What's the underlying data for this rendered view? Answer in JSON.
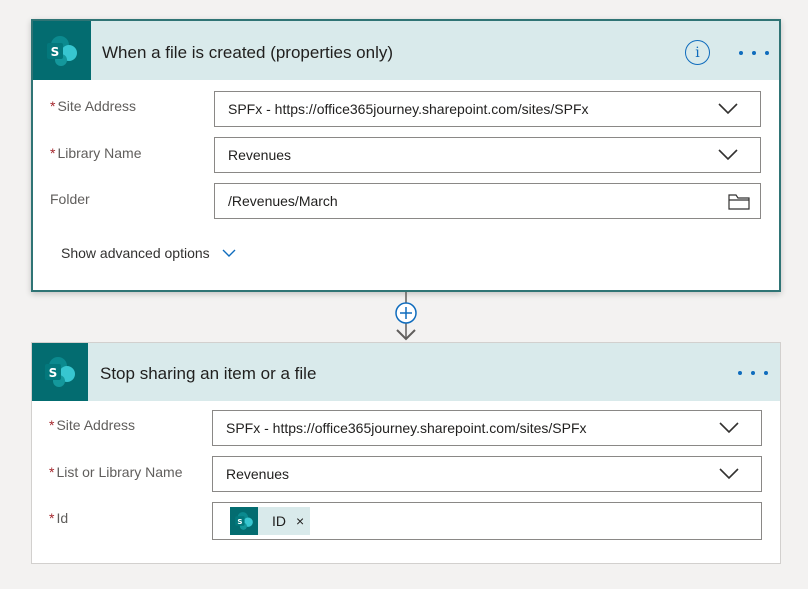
{
  "trigger": {
    "title": "When a file is created (properties only)",
    "icon": "sharepoint-icon",
    "fields": [
      {
        "label": "Site Address",
        "required_mark": "*",
        "value": "SPFx - https://office365journey.sharepoint.com/sites/SPFx"
      },
      {
        "label": "Library Name",
        "required_mark": "*",
        "value": "Revenues"
      },
      {
        "label": "Folder",
        "value": "/Revenues/March"
      }
    ],
    "advanced_label": "Show advanced options",
    "info_glyph": "i"
  },
  "action": {
    "title": "Stop sharing an item or a file",
    "icon": "sharepoint-icon",
    "fields": [
      {
        "label": "Site Address",
        "required_mark": "*",
        "value": "SPFx - https://office365journey.sharepoint.com/sites/SPFx"
      },
      {
        "label": "List or Library Name",
        "required_mark": "*",
        "value": "Revenues"
      },
      {
        "label": "Id",
        "required_mark": "*",
        "token": {
          "label": "ID",
          "remove_glyph": "×"
        }
      }
    ]
  },
  "colors": {
    "accent": "#036c70",
    "header_bg": "#d9eaeb",
    "link_blue": "#0f6cbd",
    "required_red": "#a4262c",
    "selected_border": "#2f7475"
  }
}
